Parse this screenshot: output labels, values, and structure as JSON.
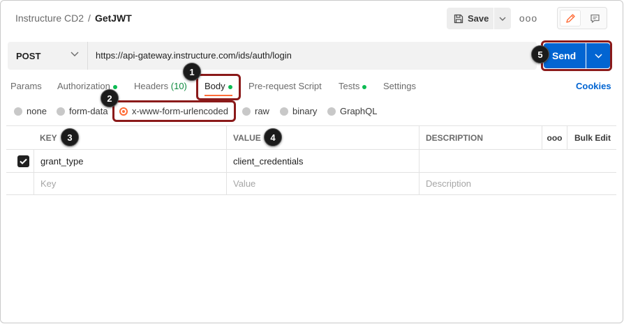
{
  "breadcrumb": {
    "parent": "Instructure CD2",
    "separator": "/",
    "current": "GetJWT"
  },
  "toolbar": {
    "save_label": "Save",
    "more_label": "ooo"
  },
  "request": {
    "method": "POST",
    "url": "https://api-gateway.instructure.com/ids/auth/login",
    "send_label": "Send"
  },
  "tabs": {
    "params": "Params",
    "authorization": "Authorization",
    "headers": "Headers",
    "headers_count": "(10)",
    "body": "Body",
    "pre_request": "Pre-request Script",
    "tests": "Tests",
    "settings": "Settings",
    "cookies": "Cookies"
  },
  "body_types": {
    "none": "none",
    "form_data": "form-data",
    "urlencoded": "x-www-form-urlencoded",
    "raw": "raw",
    "binary": "binary",
    "graphql": "GraphQL",
    "selected": "x-www-form-urlencoded"
  },
  "table": {
    "key_header": "KEY",
    "value_header": "VALUE",
    "description_header": "DESCRIPTION",
    "more_label": "ooo",
    "bulk_edit": "Bulk Edit",
    "rows": [
      {
        "checked": true,
        "key": "grant_type",
        "value": "client_credentials",
        "description": ""
      }
    ],
    "placeholder": {
      "key": "Key",
      "value": "Value",
      "description": "Description"
    }
  },
  "callouts": [
    "1",
    "2",
    "3",
    "4",
    "5"
  ],
  "colors": {
    "accent_orange": "#ff6c37",
    "send_blue": "#0265d2",
    "highlight_red": "#8b1a1a",
    "active_dot_green": "#0cbb52",
    "link_blue": "#0265d2"
  },
  "icons": [
    "save-icon",
    "chevron-down-icon",
    "more-icon",
    "pencil-icon",
    "comment-icon",
    "checkmark-icon"
  ]
}
